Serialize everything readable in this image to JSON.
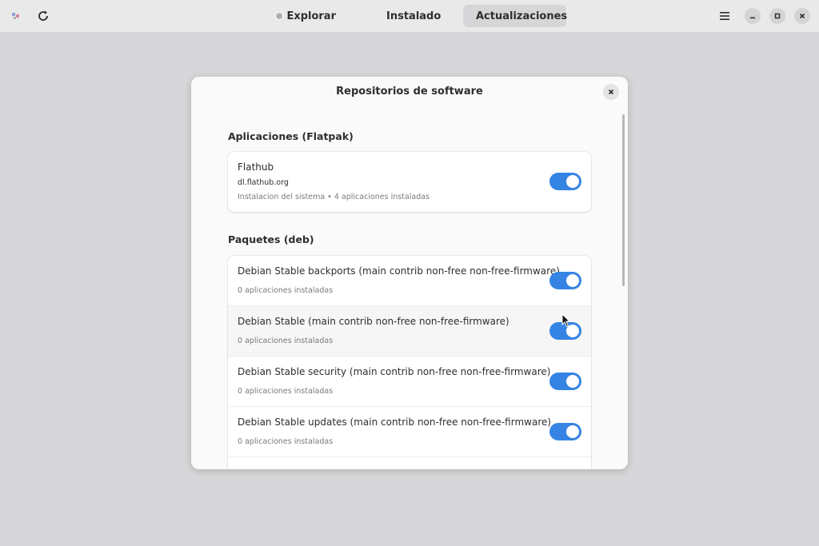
{
  "header": {
    "tabs": [
      {
        "label": "Explorar",
        "icon": "compass-icon",
        "active": false
      },
      {
        "label": "Instalado",
        "icon": "library-icon",
        "active": false
      },
      {
        "label": "Actualizaciones",
        "icon": "update-icon",
        "active": true
      }
    ]
  },
  "dialog": {
    "title": "Repositorios de software",
    "flatpak": {
      "heading": "Aplicaciones (Flatpak)",
      "name": "Flathub",
      "url": "dl.flathub.org",
      "info": "Instalacion del sistema • 4 aplicaciones instaladas",
      "enabled": true
    },
    "deb": {
      "heading": "Paquetes (deb)",
      "rows": [
        {
          "title": "Debian Stable backports (main contrib non-free non-free-firmware)",
          "subtitle": "0 aplicaciones instaladas",
          "enabled": true
        },
        {
          "title": "Debian Stable (main contrib non-free non-free-firmware)",
          "subtitle": "0 aplicaciones instaladas",
          "enabled": true
        },
        {
          "title": "Debian Stable security (main contrib non-free non-free-firmware)",
          "subtitle": "0 aplicaciones instaladas",
          "enabled": true
        },
        {
          "title": "Debian Stable updates (main contrib non-free non-free-firmware)",
          "subtitle": "0 aplicaciones instaladas",
          "enabled": true
        }
      ]
    }
  },
  "colors": {
    "accent": "#3584e4",
    "background": "#d7d7d9",
    "headerbar": "#e9e9ea",
    "dialog": "#fafafa"
  }
}
